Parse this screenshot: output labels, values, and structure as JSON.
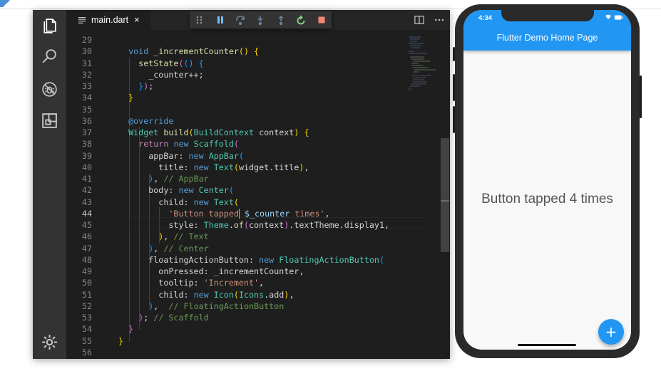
{
  "editor": {
    "tab": {
      "filename": "main.dart",
      "close": "×"
    },
    "colors": {
      "background": "#1e1e1e",
      "activity_bar": "#333333"
    },
    "activity_bar": [
      {
        "name": "explorer",
        "icon": "files-icon"
      },
      {
        "name": "search",
        "icon": "search-icon"
      },
      {
        "name": "debug",
        "icon": "debug-icon"
      },
      {
        "name": "extensions",
        "icon": "extensions-icon"
      }
    ],
    "settings_icon": "gear-icon",
    "debug_toolbar": [
      "drag-handle-icon",
      "pause-icon",
      "step-over-icon",
      "step-into-icon",
      "step-out-icon",
      "restart-icon",
      "stop-icon"
    ],
    "lines": [
      {
        "n": "29",
        "text": ""
      },
      {
        "n": "30",
        "text": "  void _incrementCounter() {"
      },
      {
        "n": "31",
        "text": "    setState(() {"
      },
      {
        "n": "32",
        "text": "      _counter++;"
      },
      {
        "n": "33",
        "text": "    });"
      },
      {
        "n": "34",
        "text": "  }"
      },
      {
        "n": "35",
        "text": ""
      },
      {
        "n": "36",
        "text": "  @override"
      },
      {
        "n": "37",
        "text": "  Widget build(BuildContext context) {"
      },
      {
        "n": "38",
        "text": "    return new Scaffold("
      },
      {
        "n": "39",
        "text": "      appBar: new AppBar("
      },
      {
        "n": "40",
        "text": "        title: new Text(widget.title),"
      },
      {
        "n": "41",
        "text": "      ), // AppBar"
      },
      {
        "n": "42",
        "text": "      body: new Center("
      },
      {
        "n": "43",
        "text": "        child: new Text("
      },
      {
        "n": "44",
        "text": "          'Button tapped $_counter times',"
      },
      {
        "n": "45",
        "text": "          style: Theme.of(context).textTheme.display1,"
      },
      {
        "n": "46",
        "text": "        ), // Text"
      },
      {
        "n": "47",
        "text": "      ), // Center"
      },
      {
        "n": "48",
        "text": "      floatingActionButton: new FloatingActionButton("
      },
      {
        "n": "49",
        "text": "        onPressed: _incrementCounter,"
      },
      {
        "n": "50",
        "text": "        tooltip: 'Increment',"
      },
      {
        "n": "51",
        "text": "        child: new Icon(Icons.add),"
      },
      {
        "n": "52",
        "text": "      ),  // FloatingActionButton"
      },
      {
        "n": "53",
        "text": "    ); // Scaffold"
      },
      {
        "n": "54",
        "text": "  }"
      },
      {
        "n": "55",
        "text": "}"
      },
      {
        "n": "56",
        "text": ""
      }
    ]
  },
  "phone": {
    "time": "4:34",
    "app_title": "Flutter Demo Home Page",
    "body_text": "Button tapped 4 times",
    "fab_icon": "+",
    "colors": {
      "primary": "#2196f3",
      "background": "#f8f8f8",
      "frame": "#2a2a2a"
    }
  }
}
